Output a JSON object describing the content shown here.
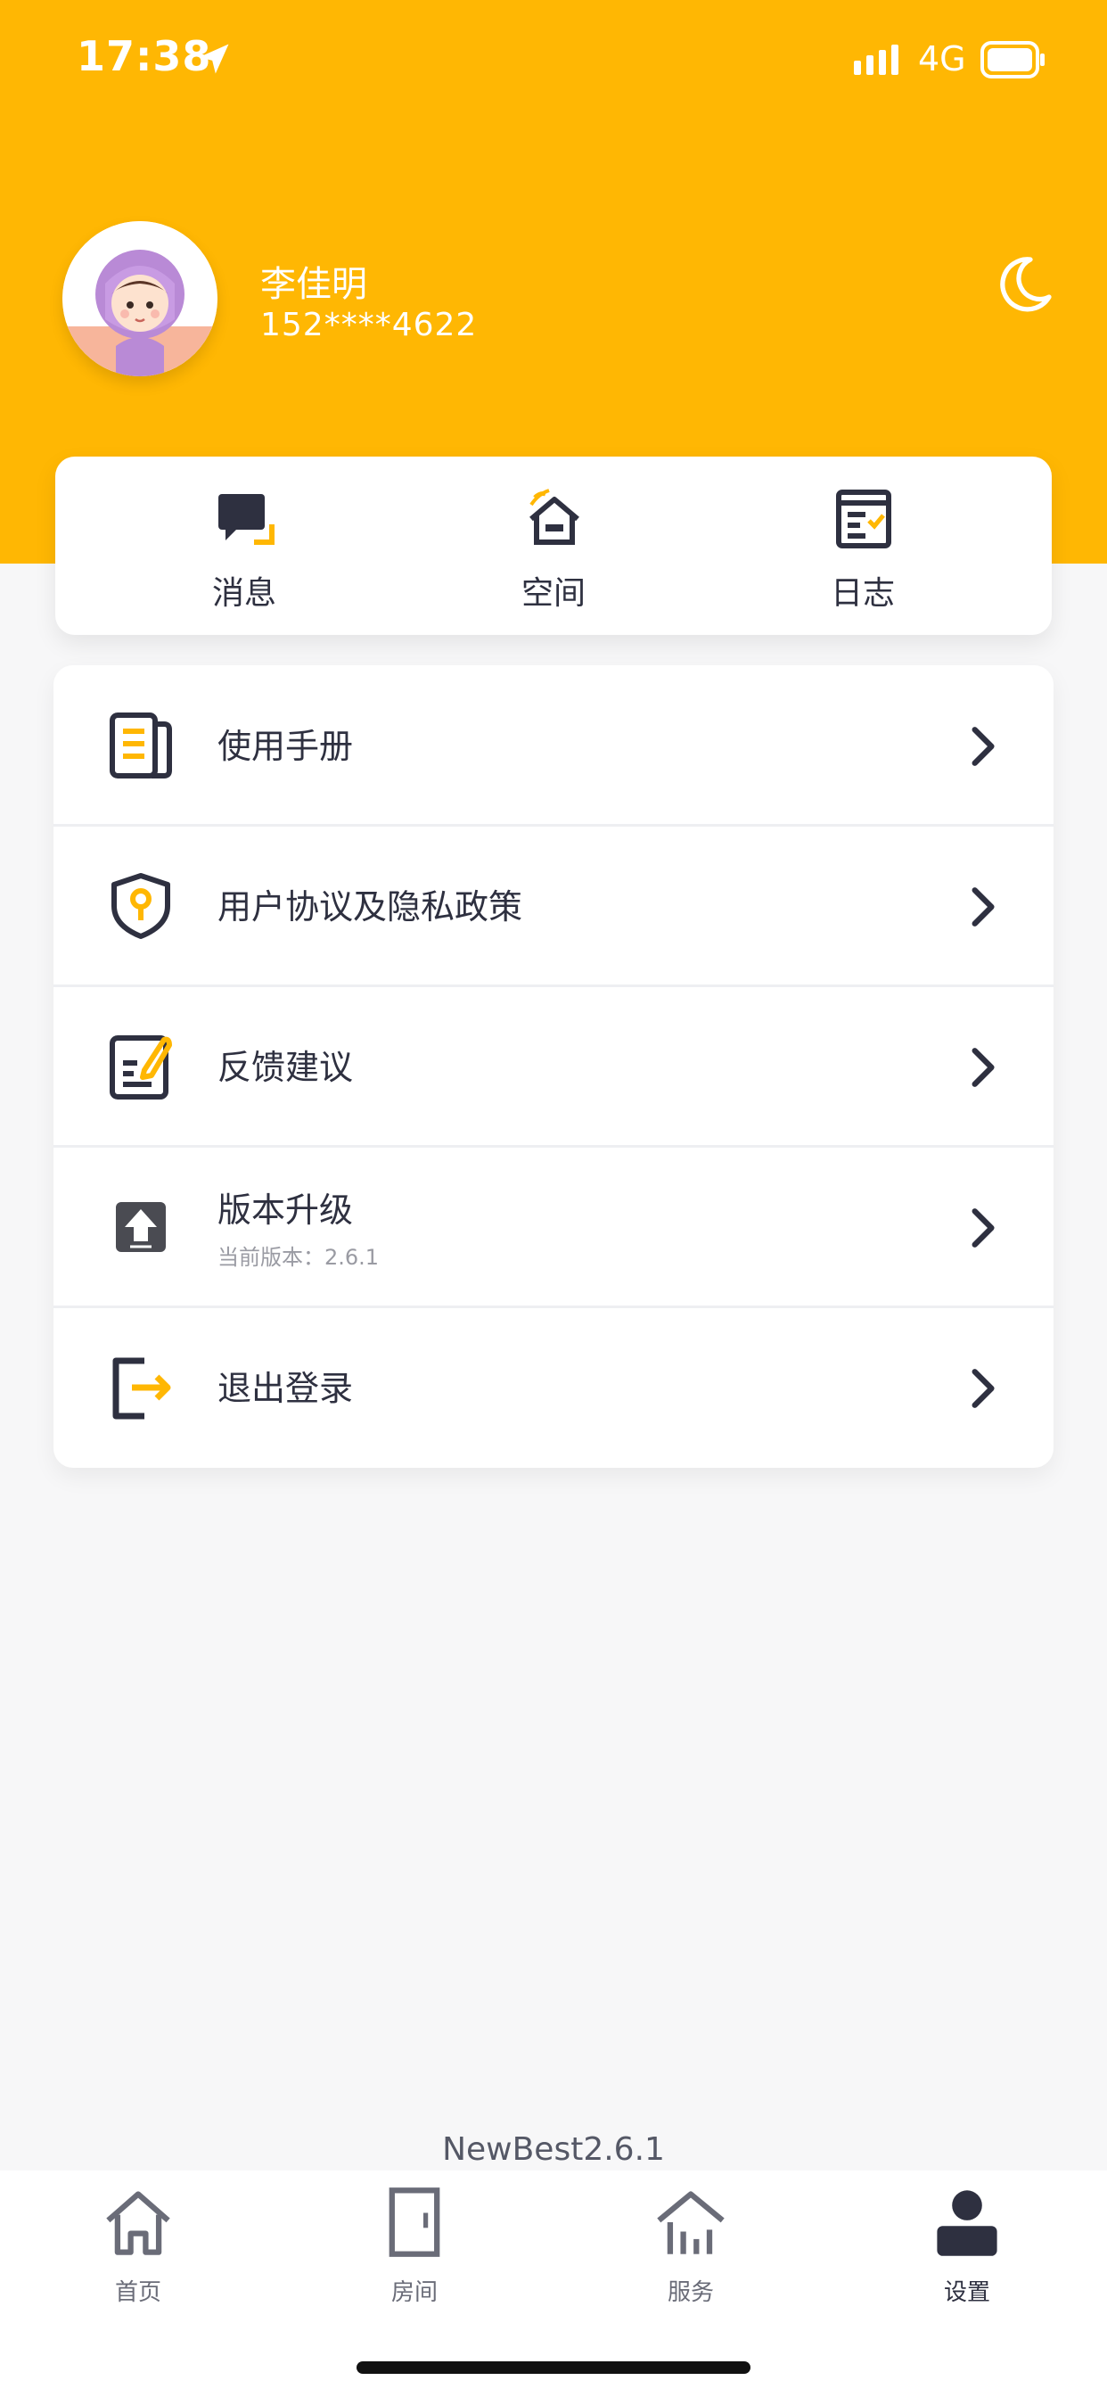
{
  "status_bar": {
    "time": "17:38",
    "network": "4G",
    "icons": [
      "location-arrow-icon",
      "signal-icon",
      "battery-icon"
    ]
  },
  "profile": {
    "name": "李佳明",
    "phone": "152****4622",
    "theme_icon": "moon-icon"
  },
  "quick_actions": [
    {
      "label": "消息",
      "icon": "message-icon"
    },
    {
      "label": "空间",
      "icon": "home-signal-icon"
    },
    {
      "label": "日志",
      "icon": "log-icon"
    }
  ],
  "menu": [
    {
      "label": "使用手册",
      "icon": "manual-icon"
    },
    {
      "label": "用户协议及隐私政策",
      "icon": "shield-key-icon"
    },
    {
      "label": "反馈建议",
      "icon": "feedback-icon"
    },
    {
      "label": "版本升级",
      "sub": "当前版本：2.6.1",
      "icon": "upgrade-icon"
    },
    {
      "label": "退出登录",
      "icon": "logout-icon"
    }
  ],
  "app_version": "NewBest2.6.1",
  "tabs": [
    {
      "label": "首页",
      "icon": "home-icon",
      "active": false
    },
    {
      "label": "房间",
      "icon": "door-icon",
      "active": false
    },
    {
      "label": "服务",
      "icon": "service-icon",
      "active": false
    },
    {
      "label": "设置",
      "icon": "user-icon",
      "active": true
    }
  ],
  "colors": {
    "accent": "#ffb703",
    "ink": "#2e3040",
    "background": "#f7f7f8"
  }
}
